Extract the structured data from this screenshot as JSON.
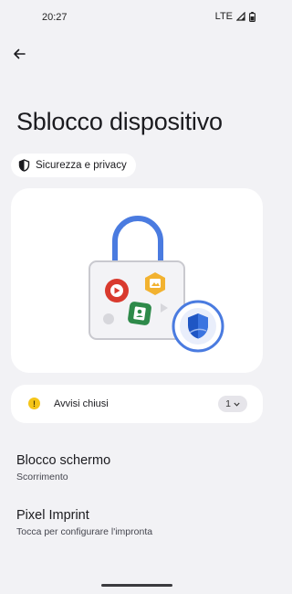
{
  "status_bar": {
    "time": "20:27",
    "network": "LTE",
    "icons": [
      "signal-icon",
      "battery-icon"
    ]
  },
  "header": {
    "back_icon": "arrow-back-icon",
    "title": "Sblocco dispositivo"
  },
  "chip": {
    "icon": "shield-outline-icon",
    "label": "Sicurezza e privacy"
  },
  "illustration": {
    "description_icons": [
      "padlock-icon",
      "video-app-icon",
      "photos-app-icon",
      "contact-app-icon",
      "security-shield-icon"
    ],
    "colors": {
      "shackle": "#4a7be0",
      "red": "#d93a2e",
      "yellow": "#f2b230",
      "green": "#2e8a4a",
      "shield": "#1f56c4"
    }
  },
  "alerts": {
    "icon": "warning-icon",
    "label": "Avvisi chiusi",
    "count": "1",
    "chevron": "chevron-down-icon"
  },
  "preferences": [
    {
      "title": "Blocco schermo",
      "subtitle": "Scorrimento"
    },
    {
      "title": "Pixel Imprint",
      "subtitle": "Tocca per configurare l'impronta"
    }
  ]
}
